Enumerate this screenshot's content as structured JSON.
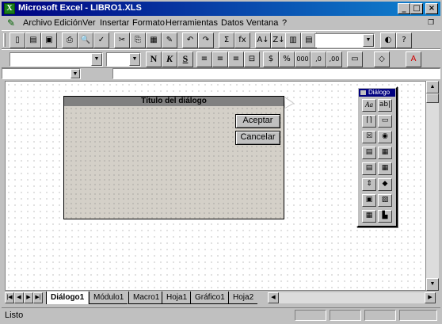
{
  "window": {
    "title": "Microsoft Excel - LIBRO1.XLS",
    "minimize": "_",
    "maximize": "□",
    "close": "×"
  },
  "menu": {
    "items": [
      "Archivo",
      "Edición",
      "Ver",
      "Insertar",
      "Formato",
      "Herramientas",
      "Datos",
      "Ventana",
      "?"
    ]
  },
  "toolbar1": {
    "icons": [
      "new-icon",
      "open-icon",
      "save-icon",
      "print-icon",
      "print-preview-icon",
      "spelling-icon",
      "cut-icon",
      "copy-icon",
      "paste-icon",
      "format-painter-icon",
      "undo-icon",
      "redo-icon",
      "autosum-icon",
      "function-wizard-icon",
      "sort-ascending-icon",
      "sort-descending-icon",
      "chart-wizard-icon",
      "text-box-icon",
      "drawing-icon",
      "zoom-combo",
      "tipwizard-icon",
      "help-icon"
    ],
    "glyphs": [
      "▯",
      "▤",
      "▣",
      "⎙",
      "🔍",
      "✓",
      "✂",
      "⎘",
      "▦",
      "✎",
      "↶",
      "↷",
      "Σ",
      "fx",
      "A↓",
      "Z↓",
      "▥",
      "▤",
      "✐",
      "",
      "◐",
      "?"
    ]
  },
  "toolbar2": {
    "bold": "N",
    "italic": "K",
    "underline": "S",
    "glyphs": [
      "≡",
      "≡",
      "≡",
      "⊟",
      "$",
      "%",
      "000",
      ",0",
      ",00",
      "▭",
      "◇",
      "A"
    ]
  },
  "dialog": {
    "title": "Título del diálogo",
    "ok_label": "Aceptar",
    "cancel_label": "Cancelar"
  },
  "palette": {
    "title": "Diálogo",
    "buttons": [
      "Aa",
      "ab|",
      "⌈⌉",
      "▭",
      "☒",
      "◉",
      "▤",
      "▦",
      "▤",
      "▦",
      "⇕",
      "◆",
      "▣",
      "▨",
      "▦",
      "▙"
    ]
  },
  "sheet_tabs": [
    "Diálogo1",
    "Módulo1",
    "Macro1",
    "Hoja1",
    "Gráfico1",
    "Hoja2"
  ],
  "nav": [
    "|◀",
    "◀",
    "▶",
    "▶|"
  ],
  "status": {
    "text": "Listo"
  }
}
